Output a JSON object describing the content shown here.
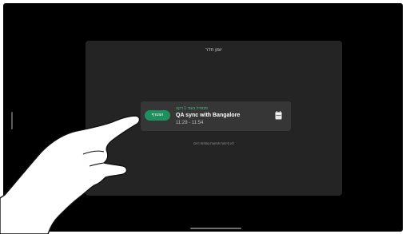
{
  "panel": {
    "title": "יומן חדר"
  },
  "meeting": {
    "status": "מתחיל בעוד 1 דקה",
    "title": "QA sync with Bangalore",
    "time": "11:29 - 11:54",
    "join_label": "הצטרף"
  },
  "footer": {
    "no_more_text": "לא קיימות פגישות נוספות היום"
  },
  "icons": {
    "calendar": "calendar-icon",
    "hand": "pointing-hand-icon"
  },
  "colors": {
    "screen_bg": "#000000",
    "panel_bg": "#242424",
    "card_bg": "#363636",
    "accent_green": "#1f8f5f",
    "status_green": "#4cc08a"
  }
}
